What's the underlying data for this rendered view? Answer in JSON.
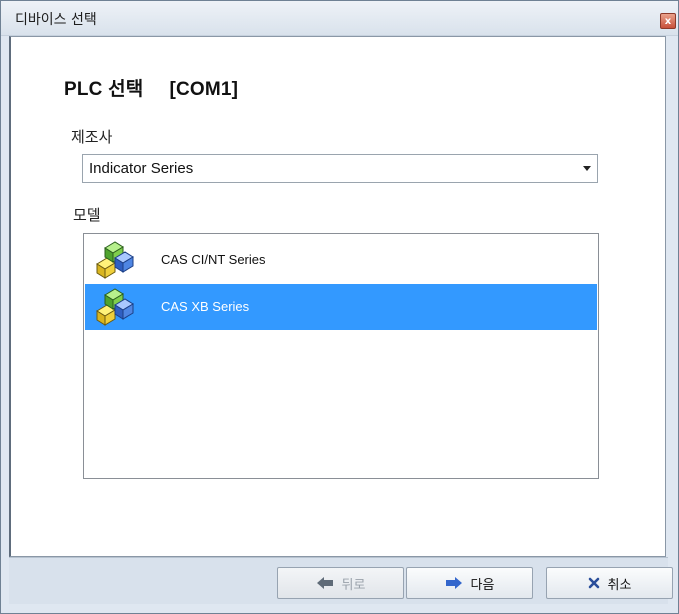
{
  "window": {
    "title": "디바이스 선택",
    "close_label": "x"
  },
  "main": {
    "heading": "PLC 선택",
    "port": "[COM1]",
    "manufacturer_label": "제조사",
    "manufacturer_value": "Indicator Series",
    "model_label": "모델",
    "models": [
      {
        "label": "CAS CI/NT Series",
        "icon": "device-model-icon",
        "selected": false
      },
      {
        "label": "CAS XB Series",
        "icon": "device-model-icon",
        "selected": true
      }
    ]
  },
  "footer": {
    "back_label": "뒤로",
    "next_label": "다음",
    "cancel_label": "취소"
  },
  "colors": {
    "selection": "#3399ff",
    "next_arrow": "#3366cc",
    "cancel_x": "#2a4e9a"
  }
}
